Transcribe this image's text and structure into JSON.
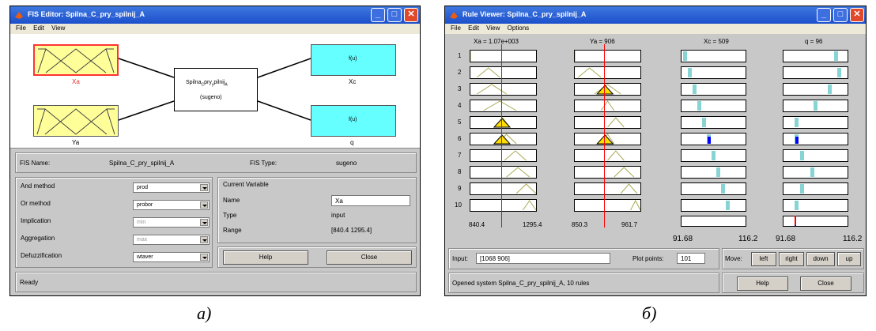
{
  "left_window": {
    "title": "FIS Editor: Spilna_C_pry_spilnij_A",
    "menu": [
      "File",
      "Edit",
      "View"
    ],
    "inputs": [
      {
        "name": "Xa",
        "selected": true
      },
      {
        "name": "Ya",
        "selected": false
      }
    ],
    "outputs": [
      "Xc",
      "q"
    ],
    "output_box_label": "f(u)",
    "system_name_lines": [
      "Spilna",
      "C",
      "pry",
      "pilnij",
      "A"
    ],
    "system_type_label": "(sugeno)",
    "fis_name_label": "FIS Name:",
    "fis_name": "Spilna_C_pry_spilnij_A",
    "fis_type_label": "FIS Type:",
    "fis_type": "sugeno",
    "methods": [
      {
        "label": "And method",
        "value": "prod",
        "disabled": false
      },
      {
        "label": "Or method",
        "value": "probor",
        "disabled": false
      },
      {
        "label": "Implication",
        "value": "min",
        "disabled": true
      },
      {
        "label": "Aggregation",
        "value": "max",
        "disabled": true
      },
      {
        "label": "Defuzzification",
        "value": "wtaver",
        "disabled": false
      }
    ],
    "current_variable_label": "Current Variable",
    "var_name_label": "Name",
    "var_name": "Xa",
    "var_type_label": "Type",
    "var_type": "input",
    "var_range_label": "Range",
    "var_range": "[840.4 1295.4]",
    "help": "Help",
    "close": "Close",
    "status": "Ready"
  },
  "right_window": {
    "title": "Rule Viewer: Spilna_C_pry_spilnij_A",
    "menu": [
      "File",
      "Edit",
      "View",
      "Options"
    ],
    "col_headers": [
      "Xa = 1.07e+003",
      "Ya = 906",
      "Xc = 509",
      "q = 96"
    ],
    "rules": [
      1,
      2,
      3,
      4,
      5,
      6,
      7,
      8,
      9,
      10
    ],
    "xa_axis": [
      "840.4",
      "1295.4"
    ],
    "ya_axis": [
      "850.3",
      "961.7"
    ],
    "xc_axis": [
      "91.68",
      "116.2"
    ],
    "q_axis": [
      "91.68",
      "116.2"
    ],
    "input_label": "Input:",
    "input_value": "[1068 906]",
    "plot_points_label": "Plot points:",
    "plot_points": "101",
    "move_label": "Move:",
    "move_buttons": [
      "left",
      "right",
      "down",
      "up"
    ],
    "status": "Opened system Spilna_C_pry_spilnij_A, 10 rules",
    "help": "Help",
    "close": "Close"
  },
  "captions": {
    "left": "а)",
    "right": "б)"
  },
  "colors": {
    "input_mf": "#ffff99",
    "output_mf": "#66ffff",
    "selected": "#ff3333",
    "fill": "#ffdd00",
    "red_line": "#ff0000",
    "bar": "#0000ff",
    "title": "#2a5fd8"
  }
}
